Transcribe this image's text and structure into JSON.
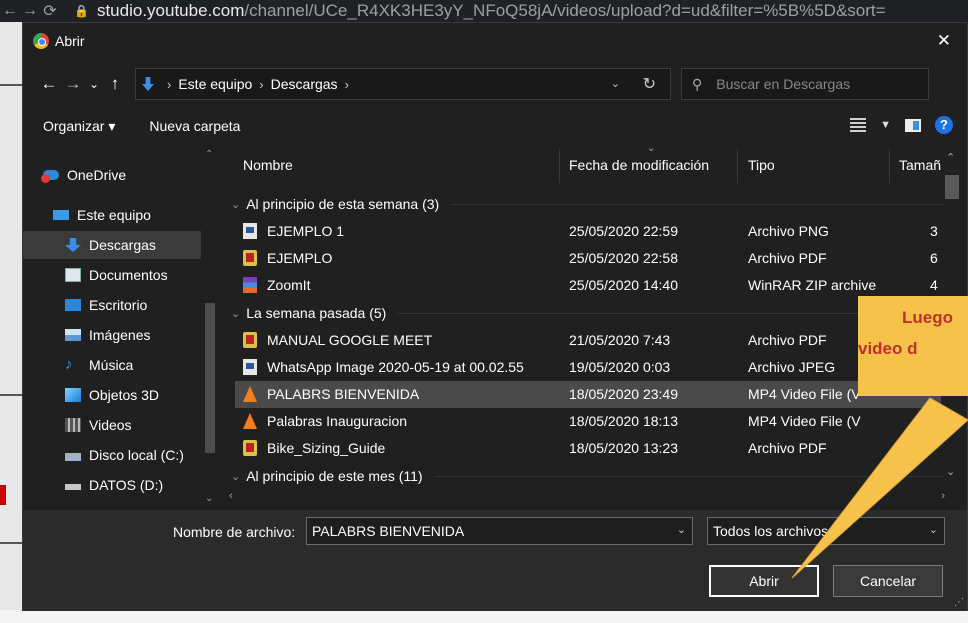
{
  "browser": {
    "url_host": "studio.youtube.com",
    "url_path": "/channel/UCe_R4XK3HE3yY_NFoQ58jA/videos/upload?d=ud&filter=%5B%5D&sort="
  },
  "dialog": {
    "title": "Abrir",
    "close": "✕",
    "breadcrumb": [
      "Este equipo",
      "Descargas"
    ],
    "search_placeholder": "Buscar en Descargas",
    "toolbar": {
      "organize": "Organizar ▾",
      "new_folder": "Nueva carpeta",
      "help": "?"
    },
    "nav_items": [
      {
        "label": "OneDrive",
        "icon": "onedrive-error-icon"
      },
      {
        "label": "Este equipo",
        "icon": "computer-icon"
      },
      {
        "label": "Descargas",
        "icon": "downloads-icon",
        "selected": true
      },
      {
        "label": "Documentos",
        "icon": "documents-icon"
      },
      {
        "label": "Escritorio",
        "icon": "desktop-icon"
      },
      {
        "label": "Imágenes",
        "icon": "pictures-icon"
      },
      {
        "label": "Música",
        "icon": "music-icon"
      },
      {
        "label": "Objetos 3D",
        "icon": "objects3d-icon"
      },
      {
        "label": "Videos",
        "icon": "videos-icon"
      },
      {
        "label": "Disco local (C:)",
        "icon": "local-disk-icon"
      },
      {
        "label": "DATOS (D:)",
        "icon": "drive-icon"
      }
    ],
    "columns": [
      "Nombre",
      "Fecha de modificación",
      "Tipo",
      "Tamañ"
    ],
    "groups": [
      {
        "label": "Al principio de esta semana (3)",
        "files": [
          {
            "name": "EJEMPLO 1",
            "date": "25/05/2020 22:59",
            "type": "Archivo PNG",
            "size": "3",
            "icon": "png-file-icon"
          },
          {
            "name": "EJEMPLO",
            "date": "25/05/2020 22:58",
            "type": "Archivo PDF",
            "size": "6",
            "icon": "pdf-file-icon"
          },
          {
            "name": "ZoomIt",
            "date": "25/05/2020 14:40",
            "type": "WinRAR ZIP archive",
            "size": "4",
            "icon": "winrar-zip-icon"
          }
        ]
      },
      {
        "label": "La semana pasada (5)",
        "files": [
          {
            "name": "MANUAL GOOGLE MEET",
            "date": "21/05/2020 7:43",
            "type": "Archivo PDF",
            "size": "",
            "icon": "pdf-file-icon"
          },
          {
            "name": "WhatsApp Image 2020-05-19 at 00.02.55",
            "date": "19/05/2020 0:03",
            "type": "Archivo JPEG",
            "size": "",
            "icon": "jpeg-file-icon"
          },
          {
            "name": "PALABRS BIENVENIDA",
            "date": "18/05/2020 23:49",
            "type": "MP4 Video File (V",
            "size": "",
            "icon": "vlc-file-icon",
            "selected": true
          },
          {
            "name": "Palabras Inauguracion",
            "date": "18/05/2020 18:13",
            "type": "MP4 Video File (V",
            "size": "",
            "icon": "vlc-file-icon"
          },
          {
            "name": "Bike_Sizing_Guide",
            "date": "18/05/2020 13:23",
            "type": "Archivo PDF",
            "size": "",
            "icon": "pdf-file-icon"
          }
        ]
      },
      {
        "label": "Al principio de este mes (11)",
        "files": []
      }
    ],
    "filename_label": "Nombre de archivo:",
    "filename_value": "PALABRS BIENVENIDA",
    "filter_value": "Todos los archivos",
    "open_button": "Abrir",
    "cancel_button": "Cancelar"
  },
  "callout": {
    "line1": "Luego",
    "line2": "video d",
    "color": "#f7c24a",
    "text_color": "#c0312b"
  }
}
